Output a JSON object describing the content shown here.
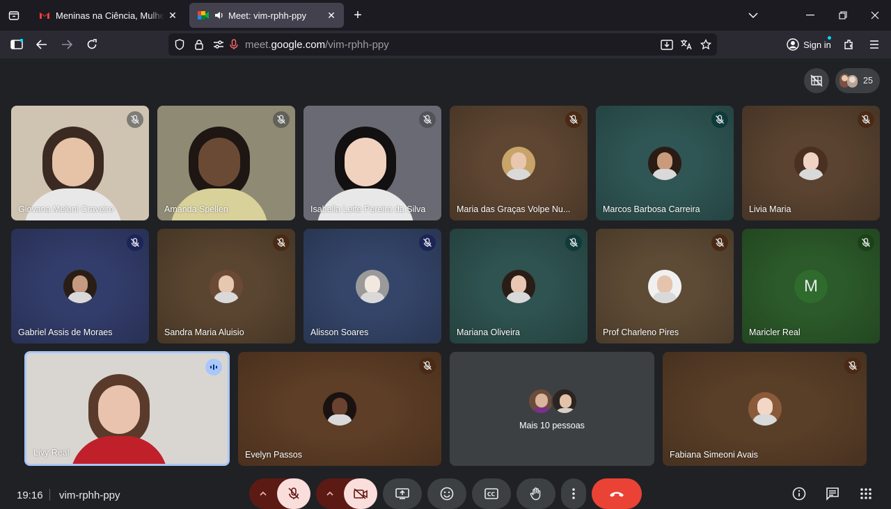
{
  "browser": {
    "tabs": [
      {
        "title": "Meninas na Ciência, Mulheres na Computação",
        "icon": "gmail-icon",
        "active": false
      },
      {
        "title": "Meet: vim-rphh-ppy",
        "icon": "meet-icon",
        "active": true
      }
    ],
    "url_host": "meet.google.com",
    "url_path": "/vim-rphh-ppy",
    "url_prefix": "meet.",
    "url_domain": "google.com",
    "sign_in": "Sign in"
  },
  "meet": {
    "participant_count": "25",
    "clock": "19:16",
    "meeting_code": "vim-rphh-ppy",
    "overflow_label": "Mais 10 pessoas",
    "participants": [
      {
        "name": "Giovana Meloni Craveiro",
        "kind": "video",
        "bg": "#cfc4b2",
        "muted": true,
        "mic_bg": "rgba(60,64,67,.55)"
      },
      {
        "name": "Amanda Spellen",
        "kind": "video",
        "bg": "#8f8a73",
        "muted": true,
        "mic_bg": "rgba(60,64,67,.55)"
      },
      {
        "name": "Isabella Leite Pereira da Silva",
        "kind": "video",
        "bg": "#6a6a74",
        "muted": true,
        "mic_bg": "rgba(60,64,67,.55)"
      },
      {
        "name": "Maria das Graças Volpe Nu...",
        "kind": "avatar",
        "bg": "#5e4632",
        "muted": true,
        "mic_bg": "#4a2a14"
      },
      {
        "name": "Marcos Barbosa Carreira",
        "kind": "avatar",
        "bg": "#2f5654",
        "muted": true,
        "mic_bg": "#0f3a3a"
      },
      {
        "name": "Livia Maria",
        "kind": "avatar",
        "bg": "#5a4330",
        "muted": true,
        "mic_bg": "#4a2a14"
      },
      {
        "name": "Gabriel Assis de Moraes",
        "kind": "avatar",
        "bg": "#333d6b",
        "muted": true,
        "mic_bg": "#1c2458"
      },
      {
        "name": "Sandra Maria Aluisio",
        "kind": "avatar",
        "bg": "#5a4530",
        "muted": true,
        "mic_bg": "#4a2a14"
      },
      {
        "name": "Alisson Soares",
        "kind": "avatar",
        "bg": "#344569",
        "muted": true,
        "mic_bg": "#1c2458"
      },
      {
        "name": "Mariana Oliveira",
        "kind": "avatar",
        "bg": "#2e5350",
        "muted": true,
        "mic_bg": "#0f3a3a"
      },
      {
        "name": "Prof Charleno Pires",
        "kind": "avatar",
        "bg": "#5e4b35",
        "muted": true,
        "mic_bg": "#4a2a14"
      },
      {
        "name": "Maricler Real",
        "kind": "letter",
        "letter": "M",
        "bg": "#2c5a2a",
        "muted": true,
        "mic_bg": "#1a4216"
      },
      {
        "name": "Livy Real",
        "kind": "video",
        "bg": "#d9d6d2",
        "muted": false,
        "speaking": true,
        "mic_bg": "#a8c7fa"
      },
      {
        "name": "Evelyn Passos",
        "kind": "avatar",
        "bg": "#5e3e26",
        "muted": true,
        "mic_bg": "#4a2a14"
      },
      {
        "name": "Fabiana Simeoni Avais",
        "kind": "avatar",
        "bg": "#5a3f28",
        "muted": true,
        "mic_bg": "#4a2a14"
      }
    ]
  },
  "colors": {
    "tab_active": "#42414d",
    "end_call": "#ea4335",
    "muted_red_bg": "#f9dedc",
    "muted_red_dark": "#601410",
    "highlight_border": "#a8c7fa"
  }
}
